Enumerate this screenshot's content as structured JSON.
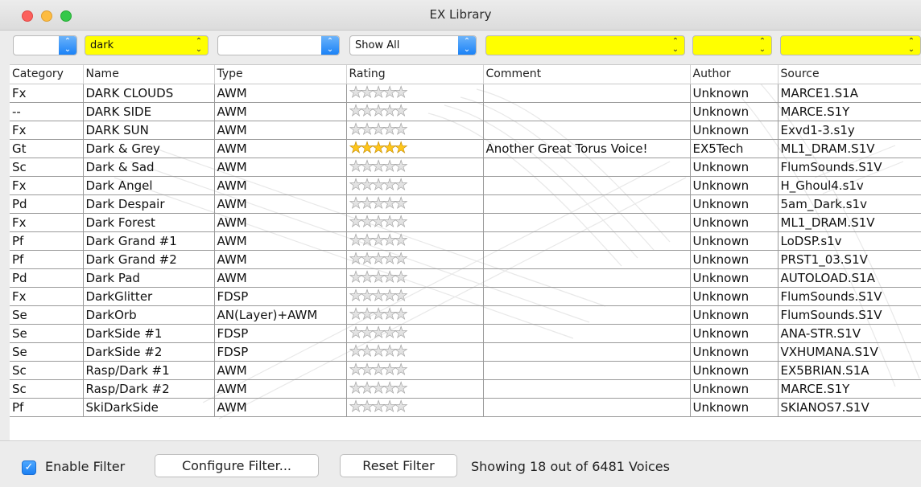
{
  "window": {
    "title": "EX Library"
  },
  "filters": {
    "category": "",
    "name": "dark",
    "type": "",
    "rating": "Show All",
    "comment": "",
    "author": "",
    "source": ""
  },
  "columns": [
    "Category",
    "Name",
    "Type",
    "Rating",
    "Comment",
    "Author",
    "Source"
  ],
  "rows": [
    {
      "category": "Fx",
      "name": "DARK CLOUDS",
      "type": "AWM",
      "rating": 0,
      "comment": "",
      "author": "Unknown",
      "source": "MARCE1.S1A"
    },
    {
      "category": "--",
      "name": "DARK SIDE",
      "type": "AWM",
      "rating": 0,
      "comment": "",
      "author": "Unknown",
      "source": "MARCE.S1Y"
    },
    {
      "category": "Fx",
      "name": "DARK SUN",
      "type": "AWM",
      "rating": 0,
      "comment": "",
      "author": "Unknown",
      "source": "Exvd1-3.s1y"
    },
    {
      "category": "Gt",
      "name": "Dark & Grey",
      "type": "AWM",
      "rating": 5,
      "comment": "Another Great Torus Voice!",
      "author": "EX5Tech",
      "source": "ML1_DRAM.S1V"
    },
    {
      "category": "Sc",
      "name": "Dark & Sad",
      "type": "AWM",
      "rating": 0,
      "comment": "",
      "author": "Unknown",
      "source": "FlumSounds.S1V"
    },
    {
      "category": "Fx",
      "name": "Dark Angel",
      "type": "AWM",
      "rating": 0,
      "comment": "",
      "author": "Unknown",
      "source": "H_Ghoul4.s1v"
    },
    {
      "category": "Pd",
      "name": "Dark Despair",
      "type": "AWM",
      "rating": 0,
      "comment": "",
      "author": "Unknown",
      "source": "5am_Dark.s1v"
    },
    {
      "category": "Fx",
      "name": "Dark Forest",
      "type": "AWM",
      "rating": 0,
      "comment": "",
      "author": "Unknown",
      "source": "ML1_DRAM.S1V"
    },
    {
      "category": "Pf",
      "name": "Dark Grand #1",
      "type": "AWM",
      "rating": 0,
      "comment": "",
      "author": "Unknown",
      "source": "LoDSP.s1v"
    },
    {
      "category": "Pf",
      "name": "Dark Grand #2",
      "type": "AWM",
      "rating": 0,
      "comment": "",
      "author": "Unknown",
      "source": "PRST1_03.S1V"
    },
    {
      "category": "Pd",
      "name": "Dark Pad",
      "type": "AWM",
      "rating": 0,
      "comment": "",
      "author": "Unknown",
      "source": "AUTOLOAD.S1A"
    },
    {
      "category": "Fx",
      "name": "DarkGlitter",
      "type": "FDSP",
      "rating": 0,
      "comment": "",
      "author": "Unknown",
      "source": "FlumSounds.S1V"
    },
    {
      "category": "Se",
      "name": "DarkOrb",
      "type": "AN(Layer)+AWM",
      "rating": 0,
      "comment": "",
      "author": "Unknown",
      "source": "FlumSounds.S1V"
    },
    {
      "category": "Se",
      "name": "DarkSide #1",
      "type": "FDSP",
      "rating": 0,
      "comment": "",
      "author": "Unknown",
      "source": "ANA-STR.S1V"
    },
    {
      "category": "Se",
      "name": "DarkSide #2",
      "type": "FDSP",
      "rating": 0,
      "comment": "",
      "author": "Unknown",
      "source": "VXHUMANA.S1V"
    },
    {
      "category": "Sc",
      "name": "Rasp/Dark #1",
      "type": "AWM",
      "rating": 0,
      "comment": "",
      "author": "Unknown",
      "source": "EX5BRIAN.S1A"
    },
    {
      "category": "Sc",
      "name": "Rasp/Dark #2",
      "type": "AWM",
      "rating": 0,
      "comment": "",
      "author": "Unknown",
      "source": "MARCE.S1Y"
    },
    {
      "category": "Pf",
      "name": "SkiDarkSide",
      "type": "AWM",
      "rating": 0,
      "comment": "",
      "author": "Unknown",
      "source": "SKIANOS7.S1V"
    }
  ],
  "footer": {
    "enable_filter_label": "Enable Filter",
    "enable_filter_checked": true,
    "configure_button": "Configure Filter...",
    "reset_button": "Reset Filter",
    "status": "Showing 18 out of 6481 Voices"
  },
  "colors": {
    "filter_highlight": "#ffff00",
    "accent": "#1b7ff2",
    "gold_star": "#ffc61a"
  },
  "icons": {
    "combo_arrow": "up-down-chevron-icon",
    "star": "star-icon",
    "check": "checkmark-icon"
  }
}
